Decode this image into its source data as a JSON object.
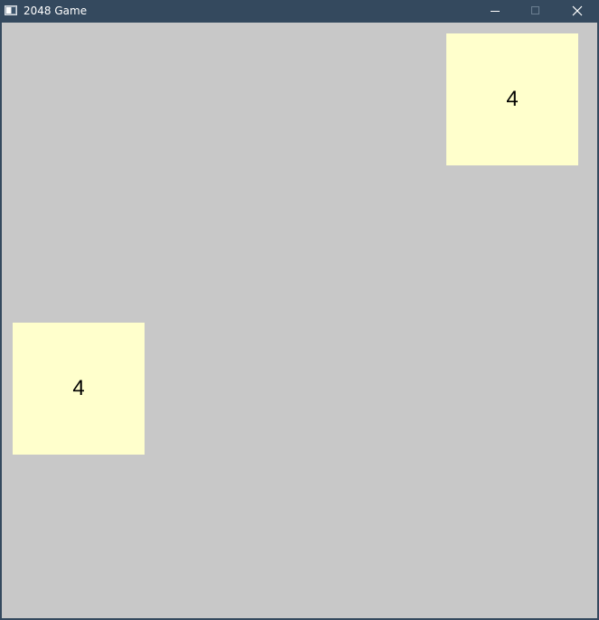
{
  "window": {
    "title": "2048 Game",
    "icon": "app-window-icon",
    "controls": {
      "minimize_icon": "minimize-icon",
      "maximize_icon": "maximize-icon",
      "close_icon": "close-icon"
    }
  },
  "colors": {
    "titlebar": "#34495e",
    "board": "#c8c8c8",
    "tile_4": "#ffffcc",
    "tile_text": "#000000"
  },
  "board": {
    "grid_size": 4,
    "cells": [
      [
        "",
        "",
        "",
        "4"
      ],
      [
        "",
        "",
        "",
        ""
      ],
      [
        "4",
        "",
        "",
        ""
      ],
      [
        "",
        "",
        "",
        ""
      ]
    ],
    "tiles": [
      {
        "value": "4",
        "row": 0,
        "col": 3
      },
      {
        "value": "4",
        "row": 2,
        "col": 0
      }
    ]
  }
}
